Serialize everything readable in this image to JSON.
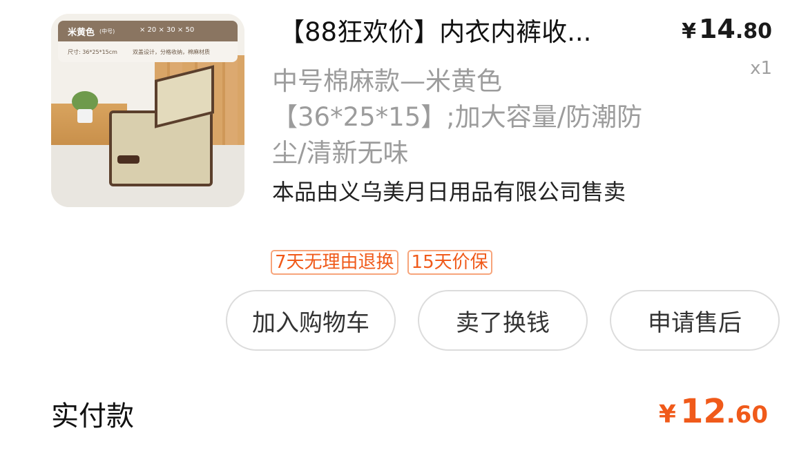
{
  "item": {
    "thumbnail": {
      "banner_title": "米黄色",
      "banner_sub": "(中号)",
      "banner_badges": "× 20   × 30   × 50",
      "banner_size": "尺寸: 36*25*15cm",
      "banner_feature": "双盖设计，分格收纳，棉麻材质"
    },
    "title": "【88狂欢价】内衣内裤收...",
    "price": {
      "currency": "¥",
      "integer": "14",
      "decimal": ".80"
    },
    "quantity": "x1",
    "spec": "中号棉麻款—米黄色【36*25*15】;加大容量/防潮防尘/清新无味",
    "seller": "本品由义乌美月日用品有限公司售卖",
    "tags": [
      "7天无理由退换",
      "15天价保"
    ],
    "buttons": {
      "add_to_cart": "加入购物车",
      "resell": "卖了换钱",
      "after_sales": "申请售后"
    }
  },
  "payment": {
    "label": "实付款",
    "currency": "¥",
    "integer": "12",
    "decimal": ".60"
  },
  "colors": {
    "accent": "#f05a1a",
    "tag_border": "#f7a47a",
    "muted_text": "#9c9c9c"
  }
}
